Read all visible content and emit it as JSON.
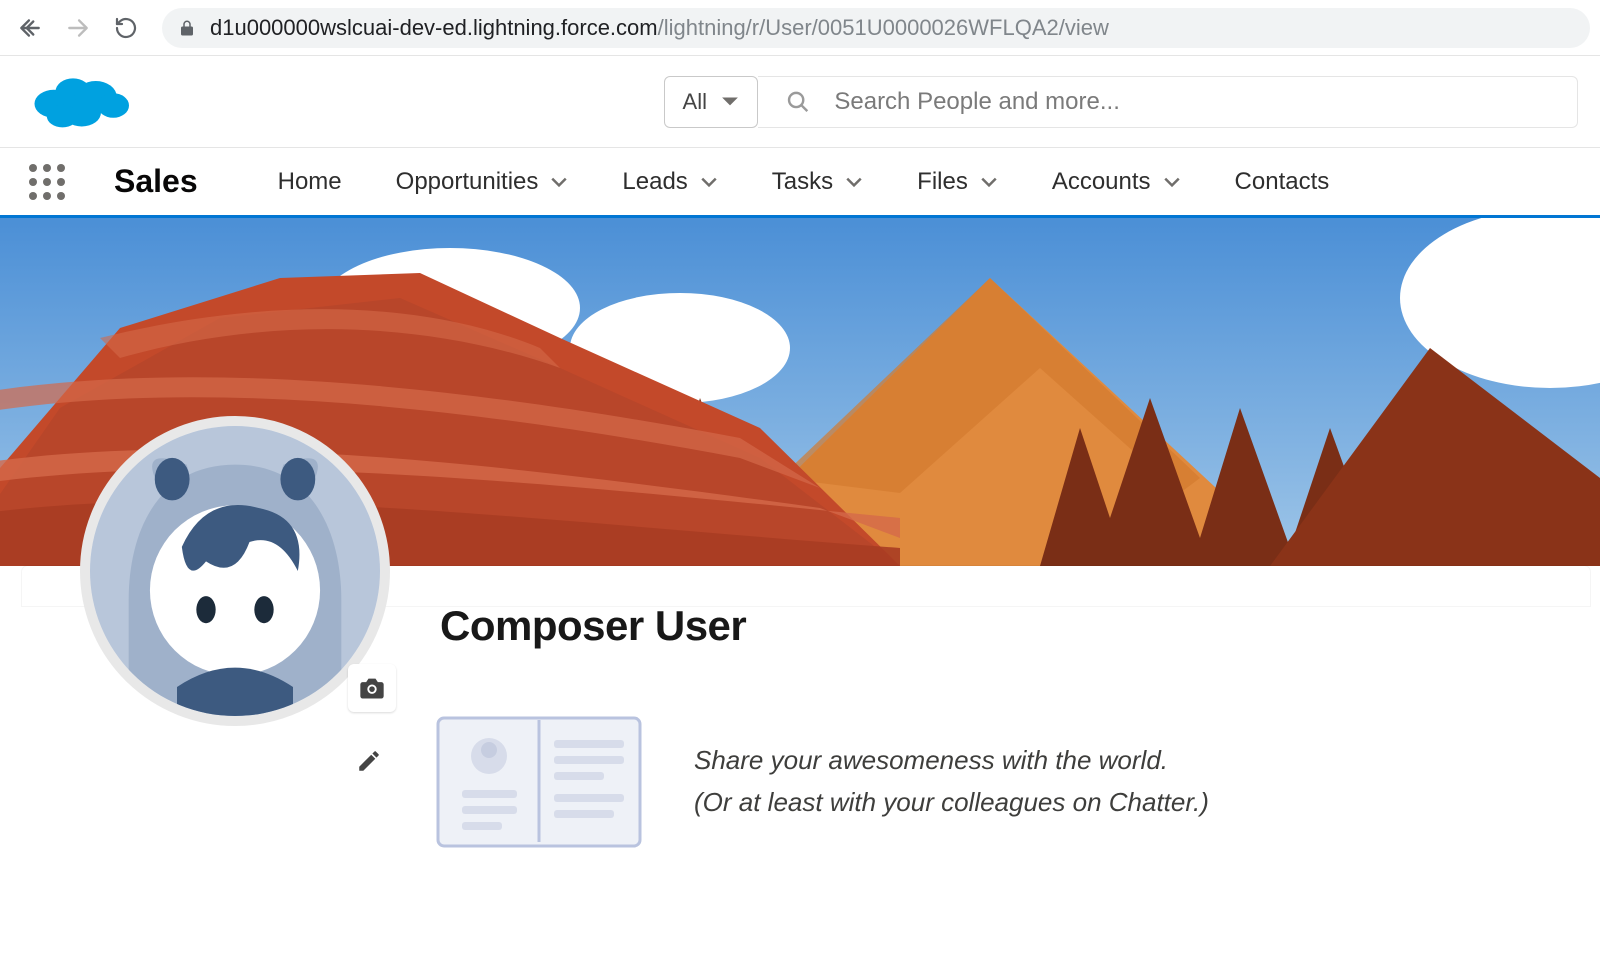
{
  "browser": {
    "url_host": "d1u000000wslcuai-dev-ed.lightning.force.com",
    "url_path": "/lightning/r/User/0051U0000026WFLQA2/view"
  },
  "header": {
    "search_scope": "All",
    "search_placeholder": "Search People and more..."
  },
  "nav": {
    "app_name": "Sales",
    "items": [
      {
        "label": "Home",
        "has_menu": false
      },
      {
        "label": "Opportunities",
        "has_menu": true
      },
      {
        "label": "Leads",
        "has_menu": true
      },
      {
        "label": "Tasks",
        "has_menu": true
      },
      {
        "label": "Files",
        "has_menu": true
      },
      {
        "label": "Accounts",
        "has_menu": true
      },
      {
        "label": "Contacts",
        "has_menu": false
      }
    ]
  },
  "profile": {
    "name": "Composer User",
    "tagline_line1": "Share your awesomeness with the world.",
    "tagline_line2": "(Or at least with your colleagues on Chatter.)"
  }
}
